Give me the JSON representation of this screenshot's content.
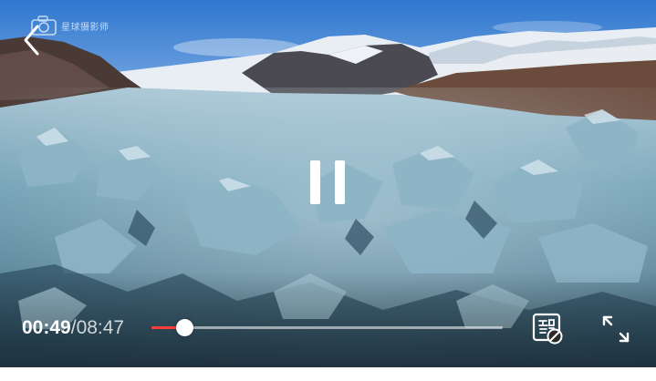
{
  "player": {
    "watermark": "星球摄影师",
    "time": {
      "current": "00:49",
      "separator": "/",
      "total": "08:47"
    },
    "progress_fraction": 0.093,
    "buffered_fraction": 0.16,
    "state": "playing"
  },
  "colors": {
    "accent": "#ff3b3b",
    "sky_top": "#2f77cf",
    "ice": "#6aa2b6"
  },
  "icons": {
    "back": "back-arrow-icon",
    "pause": "pause-icon",
    "danmaku": "danmaku-toggle-icon",
    "fullscreen": "fullscreen-icon",
    "watermark_logo": "camera-logo-icon"
  }
}
